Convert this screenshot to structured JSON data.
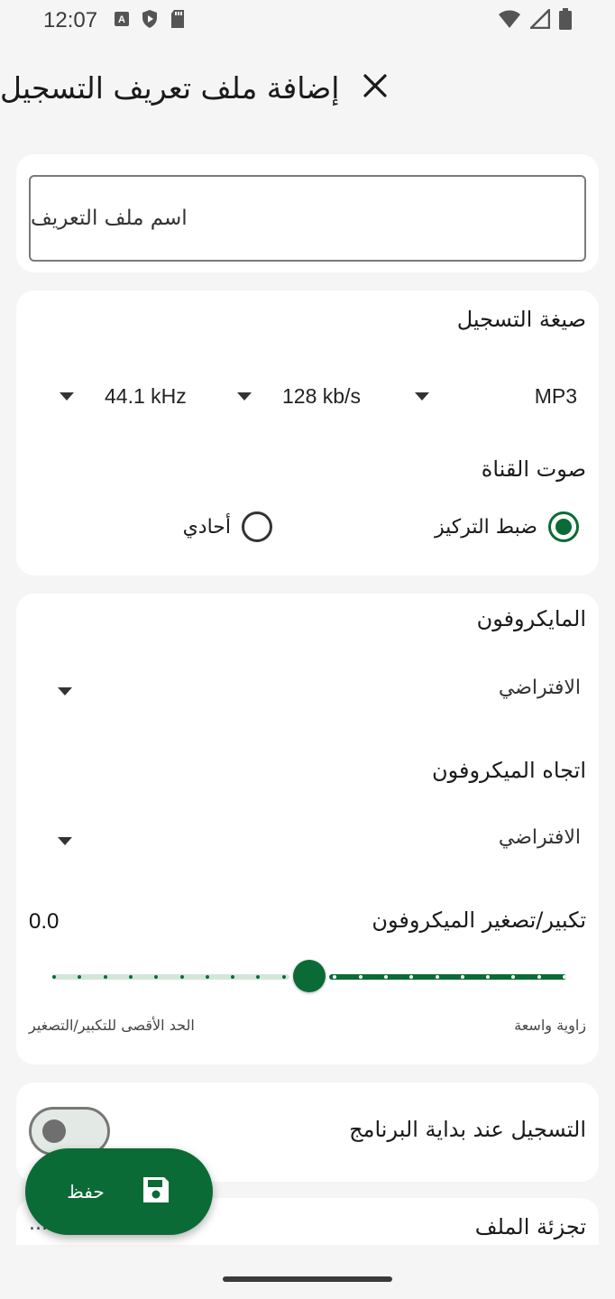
{
  "status_bar": {
    "time": "12:07",
    "icons_left": [
      "a-notification-icon",
      "shield-play-icon",
      "sd-card-icon"
    ],
    "icons_right": [
      "wifi-icon",
      "signal-icon",
      "battery-icon"
    ]
  },
  "header": {
    "title": "إضافة ملف تعريف التسجيل",
    "close_icon": "close-icon"
  },
  "profile_name": {
    "placeholder": "اسم ملف التعريف"
  },
  "format": {
    "label": "صيغة التسجيل",
    "encoder": "MP3",
    "bitrate": "128 kb/s",
    "sample_rate": "44.1 kHz"
  },
  "channel": {
    "label": "صوت القناة",
    "options": [
      {
        "label": "ضبط التركيز",
        "selected": true
      },
      {
        "label": "أحادي",
        "selected": false
      }
    ]
  },
  "microphone": {
    "label": "المايكروفون",
    "value": "الافتراضي"
  },
  "mic_direction": {
    "label": "اتجاه الميكروفون",
    "value": "الافتراضي"
  },
  "mic_zoom": {
    "label": "تكبير/تصغير الميكروفون",
    "value": "0.0",
    "fraction": 0.5,
    "caption_right": "زاوية واسعة",
    "caption_left": "الحد الأقصى للتكبير/التصغير"
  },
  "record_on_start": {
    "label": "التسجيل عند بداية البرنامج",
    "enabled": false
  },
  "file_split": {
    "label": "تجزئة الملف",
    "trailing": "..."
  },
  "fab": {
    "label": "حفظ",
    "icon": "save-icon"
  },
  "colors": {
    "accent": "#0a6b36",
    "track_inactive": "#d4e6da",
    "background": "#f5f5f5",
    "card": "#ffffff"
  }
}
